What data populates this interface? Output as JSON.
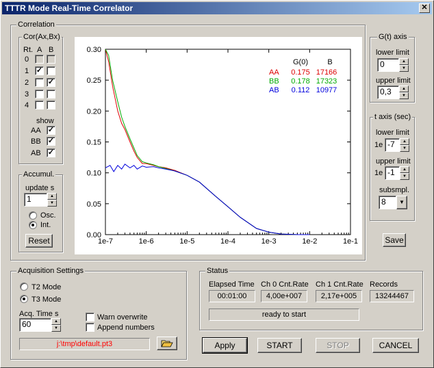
{
  "window": {
    "title": "TTTR Mode Real-Time Correlator",
    "close_symbol": "✕"
  },
  "correlation": {
    "label": "Correlation",
    "cor_label": "Cor(Ax,Bx)",
    "col_rt": "Rt.",
    "col_a": "A",
    "col_b": "B",
    "rows": [
      {
        "rt": "0",
        "a": false,
        "b": false,
        "disabled": true
      },
      {
        "rt": "1",
        "a": true,
        "b": false
      },
      {
        "rt": "2",
        "a": false,
        "b": true
      },
      {
        "rt": "3",
        "a": false,
        "b": false
      },
      {
        "rt": "4",
        "a": false,
        "b": false
      }
    ],
    "show_label": "show",
    "show": [
      {
        "label": "AA",
        "checked": true
      },
      {
        "label": "BB",
        "checked": true
      },
      {
        "label": "AB",
        "checked": true
      }
    ]
  },
  "accumul": {
    "label": "Accumul.",
    "update_label": "update  s",
    "update_value": "1",
    "osc_label": "Osc.",
    "int_label": "Int.",
    "selected": "int",
    "reset_label": "Reset"
  },
  "gt_axis": {
    "label": "G(t) axis",
    "lower_label": "lower limit",
    "lower_value": "0",
    "upper_label": "upper limit",
    "upper_value": "0,3"
  },
  "t_axis": {
    "label": "t axis (sec)",
    "lower_label": "lower limit",
    "prefix": "1e",
    "lower_value": "-7",
    "upper_label": "upper limit",
    "upper_value": "-1",
    "subsmpl_label": "subsmpl.",
    "subsmpl_value": "8"
  },
  "save_label": "Save",
  "acquisition": {
    "label": "Acquisition Settings",
    "t2_label": "T2 Mode",
    "t3_label": "T3 Mode",
    "mode": "t3",
    "acq_time_label": "Acq. Time  s",
    "acq_time_value": "60",
    "warn_overwrite_label": "Warn overwrite",
    "warn_overwrite": false,
    "append_numbers_label": "Append numbers",
    "append_numbers": false,
    "file_path": "j:\\tmp\\default.pt3"
  },
  "status": {
    "label": "Status",
    "headers": [
      "Elapsed Time",
      "Ch 0  Cnt.Rate",
      "Ch 1  Cnt.Rate",
      "Records"
    ],
    "values": [
      "00:01:00",
      "4,00e+007",
      "2,17e+005",
      "13244467"
    ],
    "message": "ready to start"
  },
  "buttons": {
    "apply": "Apply",
    "start": "START",
    "stop": "STOP",
    "cancel": "CANCEL"
  },
  "colors": {
    "AA": "#dd0000",
    "BB": "#00aa00",
    "AB": "#0000dd",
    "path": "#ff0000"
  },
  "chart_data": {
    "type": "line",
    "x_scale": "log",
    "xlim": [
      1e-07,
      0.1
    ],
    "ylim": [
      0,
      0.3
    ],
    "x_ticks": [
      "1e-7",
      "1e-6",
      "1e-5",
      "1e-4",
      "1e-3",
      "1e-2",
      "1e-1"
    ],
    "y_ticks": [
      "0.00",
      "0.05",
      "0.10",
      "0.15",
      "0.20",
      "0.25",
      "0.30"
    ],
    "legend_headers": [
      "G(0)",
      "B"
    ],
    "series": [
      {
        "name": "AA",
        "g0": "0.175",
        "b": "17166",
        "color": "#dd0000",
        "x": [
          1e-07,
          1.2e-07,
          1.5e-07,
          2e-07,
          2.5e-07,
          3e-07,
          4e-07,
          5e-07,
          6e-07,
          8e-07,
          1e-06,
          1.5e-06,
          2e-06,
          3e-06,
          5e-06,
          1e-05,
          2e-05,
          5e-05,
          0.0001,
          0.0002,
          0.0005,
          0.001,
          0.002,
          0.005
        ],
        "y": [
          0.3,
          0.28,
          0.24,
          0.2,
          0.18,
          0.17,
          0.15,
          0.135,
          0.125,
          0.115,
          0.115,
          0.112,
          0.11,
          0.108,
          0.104,
          0.096,
          0.085,
          0.062,
          0.045,
          0.028,
          0.01,
          0.004,
          0.001,
          0.0
        ]
      },
      {
        "name": "BB",
        "g0": "0.178",
        "b": "17323",
        "color": "#00aa00",
        "x": [
          1e-07,
          1.2e-07,
          1.5e-07,
          2e-07,
          2.5e-07,
          3e-07,
          4e-07,
          5e-07,
          6e-07,
          8e-07,
          1e-06,
          1.5e-06,
          2e-06,
          3e-06,
          5e-06,
          1e-05,
          2e-05,
          5e-05,
          0.0001,
          0.0002,
          0.0005,
          0.001,
          0.002,
          0.005
        ],
        "y": [
          0.3,
          0.29,
          0.25,
          0.215,
          0.19,
          0.175,
          0.155,
          0.14,
          0.128,
          0.118,
          0.116,
          0.113,
          0.11,
          0.107,
          0.103,
          0.096,
          0.085,
          0.062,
          0.045,
          0.028,
          0.01,
          0.004,
          0.001,
          0.0
        ]
      },
      {
        "name": "AB",
        "g0": "0.112",
        "b": "10977",
        "color": "#0000dd",
        "x": [
          1e-07,
          1.3e-07,
          1.6e-07,
          2e-07,
          2.5e-07,
          3e-07,
          4e-07,
          5e-07,
          6e-07,
          8e-07,
          1e-06,
          1.5e-06,
          2e-06,
          3e-06,
          5e-06,
          1e-05,
          2e-05,
          5e-05,
          0.0001,
          0.0002,
          0.0005,
          0.001,
          0.002,
          0.005,
          0.01
        ],
        "y": [
          0.108,
          0.112,
          0.102,
          0.112,
          0.106,
          0.114,
          0.108,
          0.112,
          0.106,
          0.111,
          0.109,
          0.11,
          0.108,
          0.106,
          0.103,
          0.096,
          0.085,
          0.062,
          0.045,
          0.028,
          0.01,
          0.004,
          0.001,
          0.0,
          0.0
        ]
      }
    ]
  }
}
